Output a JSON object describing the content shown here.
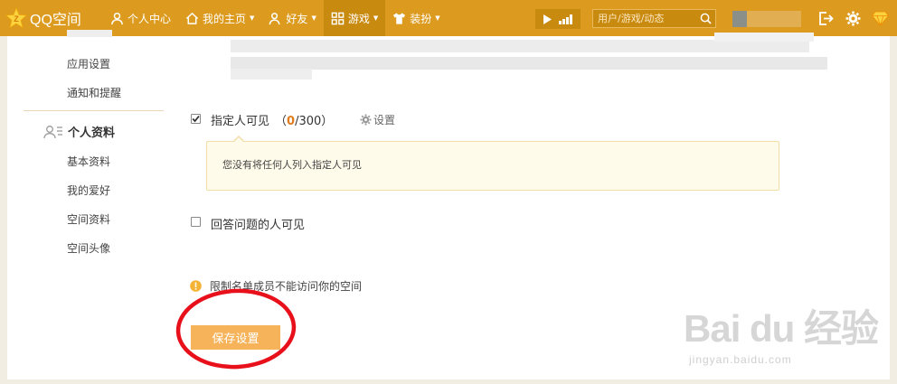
{
  "brand": {
    "logo_text": "QQ空间",
    "accent": "#dc9b1e"
  },
  "nav": {
    "items": [
      {
        "label": "个人中心",
        "icon": "person-icon",
        "has_caret": false
      },
      {
        "label": "我的主页",
        "icon": "home-icon",
        "has_caret": true
      },
      {
        "label": "好友",
        "icon": "friends-icon",
        "has_caret": true
      },
      {
        "label": "游戏",
        "icon": "grid-icon",
        "has_caret": true,
        "active": true
      },
      {
        "label": "装扮",
        "icon": "shirt-icon",
        "has_caret": true
      }
    ],
    "caret": "▼",
    "search_placeholder": "用户/游戏/动态"
  },
  "sidebar": {
    "items_top": [
      "应用设置",
      "通知和提醒"
    ],
    "section_title": "个人资料",
    "section_items": [
      "基本资料",
      "我的爱好",
      "空间资料",
      "空间头像"
    ]
  },
  "main": {
    "option1": {
      "label": "指定人可见",
      "count_open": "（",
      "count_value": "0",
      "count_total": "/300",
      "count_close": "）",
      "checked": true
    },
    "setting_link": "设置",
    "notice": "您没有将任何人列入指定人可见",
    "option2": {
      "label": "回答问题的人可见",
      "checked": false
    },
    "warning": "限制名单成员不能访问你的空间",
    "save_button": "保存设置"
  },
  "watermark": {
    "logo": "Bai du 经验",
    "sub": "jingyan.baidu.com"
  }
}
